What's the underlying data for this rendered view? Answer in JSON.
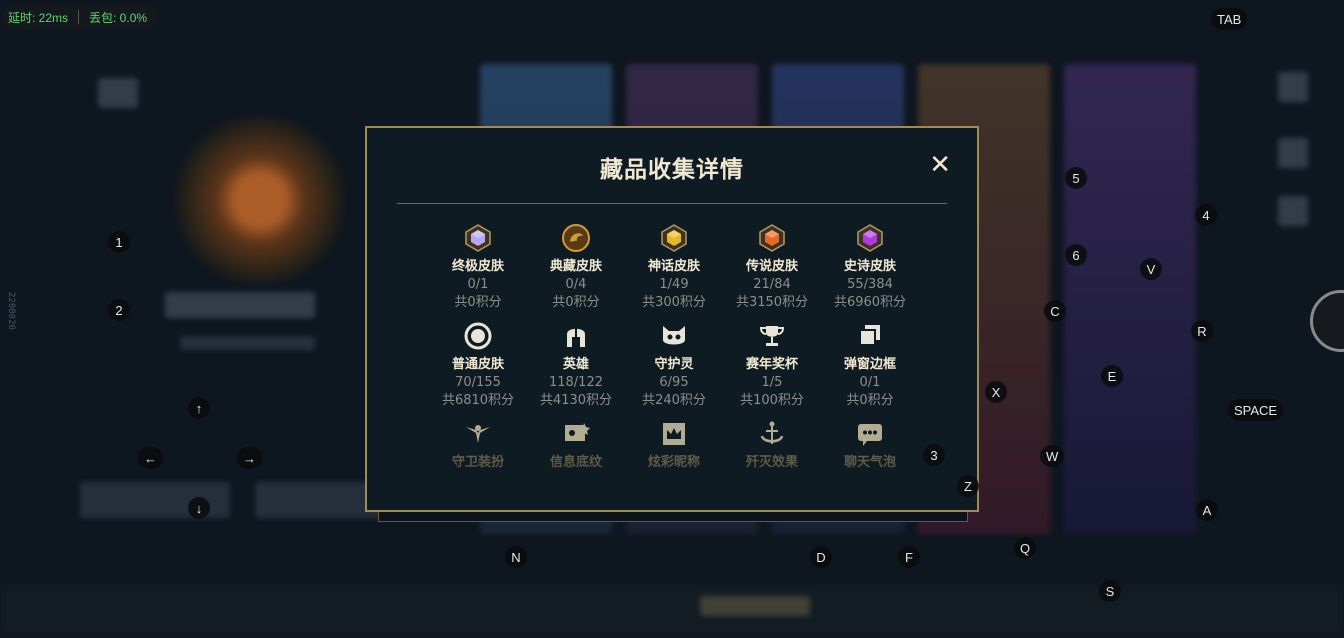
{
  "network": {
    "latency": "延时: 22ms",
    "packet_loss": "丢包: 0.0%"
  },
  "modal": {
    "title": "藏品收集详情",
    "close_glyph": "✕",
    "rows": [
      [
        {
          "name": "终极皮肤",
          "count": "0/1",
          "points": "共0积分",
          "icon": "ultimate-gem-icon",
          "color": "#b9a8f0"
        },
        {
          "name": "典藏皮肤",
          "count": "0/4",
          "points": "共0积分",
          "icon": "dragon-coin-icon",
          "color": "#d49a3a"
        },
        {
          "name": "神话皮肤",
          "count": "1/49",
          "points": "共300积分",
          "icon": "mythic-gem-icon",
          "color": "#e8b820"
        },
        {
          "name": "传说皮肤",
          "count": "21/84",
          "points": "共3150积分",
          "icon": "legendary-gem-icon",
          "color": "#e86a22"
        },
        {
          "name": "史诗皮肤",
          "count": "55/384",
          "points": "共6960积分",
          "icon": "epic-gem-icon",
          "color": "#b03ae0"
        }
      ],
      [
        {
          "name": "普通皮肤",
          "count": "70/155",
          "points": "共6810积分",
          "icon": "ring-icon",
          "color": "#e8e4d8"
        },
        {
          "name": "英雄",
          "count": "118/122",
          "points": "共4130积分",
          "icon": "helmet-icon",
          "color": "#e8e4d8"
        },
        {
          "name": "守护灵",
          "count": "6/95",
          "points": "共240积分",
          "icon": "cat-face-icon",
          "color": "#e8e4d8"
        },
        {
          "name": "赛年奖杯",
          "count": "1/5",
          "points": "共100积分",
          "icon": "trophy-icon",
          "color": "#e8e4d8"
        },
        {
          "name": "弹窗边框",
          "count": "0/1",
          "points": "共0积分",
          "icon": "frames-icon",
          "color": "#e8e4d8"
        }
      ],
      [
        {
          "name": "守卫装扮",
          "icon": "ward-icon",
          "color": "#cfc7a6"
        },
        {
          "name": "信息底纹",
          "icon": "banner-icon",
          "color": "#cfc7a6"
        },
        {
          "name": "炫彩昵称",
          "icon": "crown-card-icon",
          "color": "#cfc7a6"
        },
        {
          "name": "歼灭效果",
          "icon": "anchor-icon",
          "color": "#cfc7a6"
        },
        {
          "name": "聊天气泡",
          "icon": "chat-bubble-icon",
          "color": "#cfc7a6"
        }
      ]
    ]
  },
  "keys": [
    {
      "label": "TAB",
      "id": "key-tab"
    },
    {
      "label": "5",
      "id": "key-5"
    },
    {
      "label": "4",
      "id": "key-4"
    },
    {
      "label": "1",
      "id": "key-1"
    },
    {
      "label": "6",
      "id": "key-6"
    },
    {
      "label": "V",
      "id": "key-v"
    },
    {
      "label": "2",
      "id": "key-2"
    },
    {
      "label": "C",
      "id": "key-c"
    },
    {
      "label": "R",
      "id": "key-r"
    },
    {
      "label": "E",
      "id": "key-e"
    },
    {
      "label": "X",
      "id": "key-x"
    },
    {
      "label": "↑",
      "id": "key-up"
    },
    {
      "label": "SPACE",
      "id": "key-space"
    },
    {
      "label": "←",
      "id": "key-left"
    },
    {
      "label": "→",
      "id": "key-right"
    },
    {
      "label": "3",
      "id": "key-3"
    },
    {
      "label": "W",
      "id": "key-w"
    },
    {
      "label": "Z",
      "id": "key-z"
    },
    {
      "label": "↓",
      "id": "key-down"
    },
    {
      "label": "A",
      "id": "key-a"
    },
    {
      "label": "Q",
      "id": "key-q"
    },
    {
      "label": "N",
      "id": "key-n"
    },
    {
      "label": "D",
      "id": "key-d"
    },
    {
      "label": "F",
      "id": "key-f"
    },
    {
      "label": "S",
      "id": "key-s"
    }
  ],
  "side_id": "2208020"
}
